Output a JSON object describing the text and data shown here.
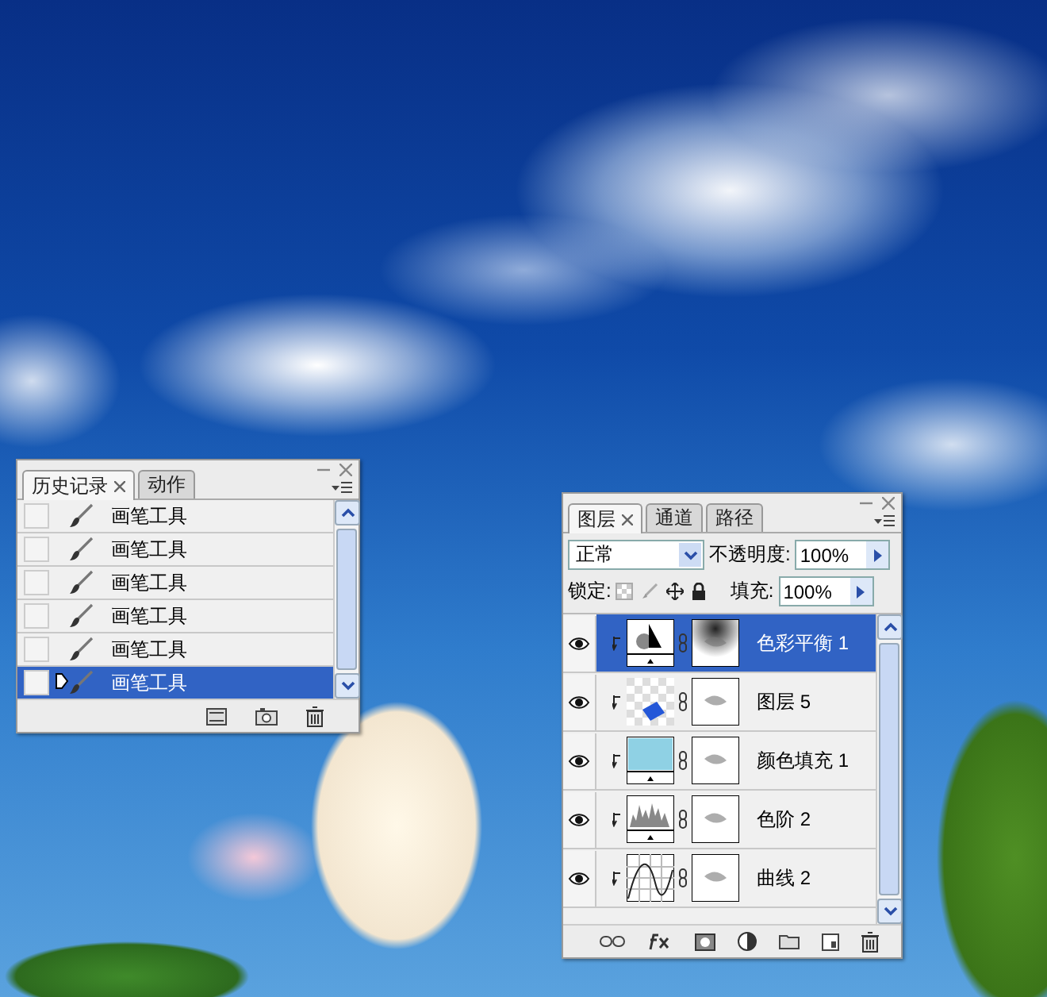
{
  "history_panel": {
    "tabs": [
      {
        "label": "历史记录",
        "selected": true
      },
      {
        "label": "动作",
        "selected": false
      }
    ],
    "items": [
      {
        "label": "画笔工具",
        "selected": false
      },
      {
        "label": "画笔工具",
        "selected": false
      },
      {
        "label": "画笔工具",
        "selected": false
      },
      {
        "label": "画笔工具",
        "selected": false
      },
      {
        "label": "画笔工具",
        "selected": false
      },
      {
        "label": "画笔工具",
        "selected": true
      }
    ]
  },
  "layers_panel": {
    "tabs": [
      {
        "label": "图层",
        "selected": true
      },
      {
        "label": "通道",
        "selected": false
      },
      {
        "label": "路径",
        "selected": false
      }
    ],
    "blend_mode": "正常",
    "opacity_label": "不透明度:",
    "opacity": "100%",
    "lock_label": "锁定:",
    "fill_label": "填充:",
    "fill": "100%",
    "layers": [
      {
        "name": "色彩平衡 1",
        "kind": "color-balance",
        "selected": true,
        "visible": true
      },
      {
        "name": "图层 5",
        "kind": "pixel",
        "selected": false,
        "visible": true
      },
      {
        "name": "颜色填充 1",
        "kind": "fill",
        "selected": false,
        "visible": true
      },
      {
        "name": "色阶 2",
        "kind": "levels",
        "selected": false,
        "visible": true
      },
      {
        "name": "曲线 2",
        "kind": "curves",
        "selected": false,
        "visible": true
      }
    ]
  }
}
